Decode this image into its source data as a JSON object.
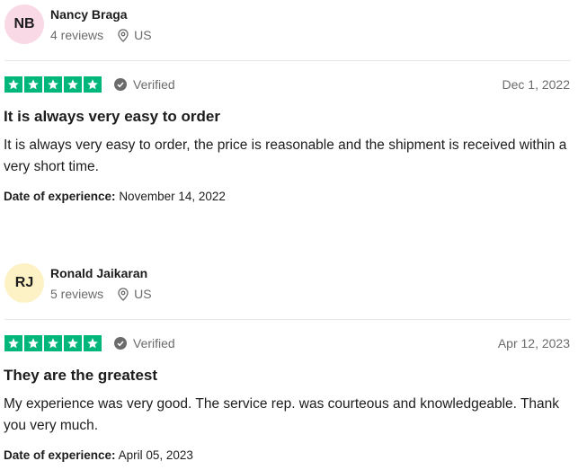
{
  "reviews": [
    {
      "initials": "NB",
      "avatar_color": "#fad9e6",
      "name": "Nancy Braga",
      "reviews_count": "4 reviews",
      "location": "US",
      "rating": 5,
      "verified_label": "Verified",
      "date": "Dec 1, 2022",
      "title": "It is always very easy to order",
      "body": "It is always very easy to order, the price is reasonable and the shipment is received within a very short time.",
      "experience_label": "Date of experience:",
      "experience_date": "November 14, 2022"
    },
    {
      "initials": "RJ",
      "avatar_color": "#fdf2c5",
      "name": "Ronald Jaikaran",
      "reviews_count": "5 reviews",
      "location": "US",
      "rating": 5,
      "verified_label": "Verified",
      "date": "Apr 12, 2023",
      "title": "They are the greatest",
      "body": "My experience was very good. The service rep. was courteous and knowledgeable. Thank you very much.",
      "experience_label": "Date of experience:",
      "experience_date": "April 05, 2023"
    }
  ],
  "colors": {
    "star_green": "#00b67a",
    "muted": "#6b6b6b",
    "text": "#1c1c1c"
  },
  "icons": {
    "location": "location-pin-icon",
    "verified": "check-circle-icon",
    "star": "star-icon"
  }
}
